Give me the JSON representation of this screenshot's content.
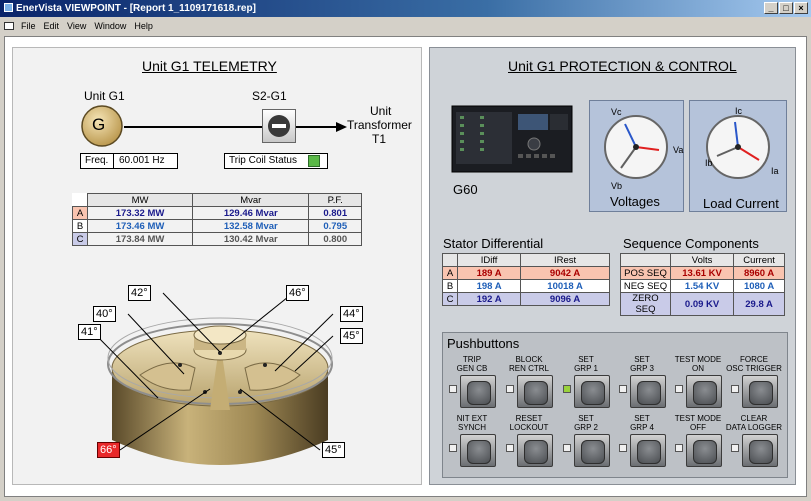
{
  "window": {
    "title": "EnerVista VIEWPOINT - [Report 1_1109171618.rep]",
    "controls": [
      "_",
      "□",
      "×"
    ]
  },
  "menu": {
    "items": [
      "File",
      "Edit",
      "View",
      "Window",
      "Help"
    ]
  },
  "telemetry": {
    "heading": "Unit G1 TELEMETRY",
    "unit_label": "Unit G1",
    "generator_symbol": "G",
    "breaker_label": "S2-G1",
    "transformer_label_1": "Unit",
    "transformer_label_2": "Transformer",
    "transformer_label_3": "T1",
    "freq_label": "Freq.",
    "freq_value": "60.001 Hz",
    "trip_coil_label": "Trip Coil Status",
    "trip_coil_color": "#5ab847",
    "table_headers": [
      "MW",
      "Mvar",
      "P.F."
    ],
    "rows": [
      {
        "phase": "A",
        "mw": "173.32 MW",
        "mvar": "129.46 Mvar",
        "pf": "0.801"
      },
      {
        "phase": "B",
        "mw": "173.46 MW",
        "mvar": "132.58 Mvar",
        "pf": "0.795"
      },
      {
        "phase": "C",
        "mw": "173.84 MW",
        "mvar": "130.42 Mvar",
        "pf": "0.800"
      }
    ],
    "temps": {
      "t42": "42°",
      "t46": "46°",
      "t40": "40°",
      "t44": "44°",
      "t41": "41°",
      "t45a": "45°",
      "t66": "66°",
      "t45b": "45°"
    },
    "alarm_color": "#e8282a"
  },
  "protection": {
    "heading": "Unit G1 PROTECTION & CONTROL",
    "relay_label": "G60",
    "voltages": {
      "label": "Voltages",
      "va": "Va",
      "vb": "Vb",
      "vc": "Vc"
    },
    "currents": {
      "label": "Load Current",
      "ia": "Ia",
      "ib": "Ib",
      "ic": "Ic"
    },
    "stator": {
      "title": "Stator Differential",
      "headers": [
        "IDiff",
        "IRest"
      ],
      "rows": [
        {
          "phase": "A",
          "idiff": "189 A",
          "irest": "9042 A"
        },
        {
          "phase": "B",
          "idiff": "198 A",
          "irest": "10018 A"
        },
        {
          "phase": "C",
          "idiff": "192 A",
          "irest": "9096 A"
        }
      ]
    },
    "sequence": {
      "title": "Sequence Components",
      "headers": [
        "Volts",
        "Current"
      ],
      "rows": [
        {
          "name": "POS SEQ",
          "volts": "13.61 KV",
          "current": "8960 A"
        },
        {
          "name": "NEG SEQ",
          "volts": "1.54 KV",
          "current": "1080 A"
        },
        {
          "name": "ZERO SEQ",
          "volts": "0.09 KV",
          "current": "29.8 A"
        }
      ]
    },
    "pushbuttons": {
      "title": "Pushbuttons",
      "buttons": [
        {
          "l1": "TRIP",
          "l2": "GEN CB",
          "led": false
        },
        {
          "l1": "BLOCK",
          "l2": "REN CTRL",
          "led": false
        },
        {
          "l1": "SET",
          "l2": "GRP 1",
          "led": true
        },
        {
          "l1": "SET",
          "l2": "GRP 3",
          "led": false
        },
        {
          "l1": "TEST MODE",
          "l2": "ON",
          "led": false
        },
        {
          "l1": "FORCE",
          "l2": "OSC TRIGGER",
          "led": false
        },
        {
          "l1": "NIT EXT",
          "l2": "SYNCH",
          "led": false
        },
        {
          "l1": "RESET",
          "l2": "LOCKOUT",
          "led": false
        },
        {
          "l1": "SET",
          "l2": "GRP 2",
          "led": false
        },
        {
          "l1": "SET",
          "l2": "GRP 4",
          "led": false
        },
        {
          "l1": "TEST MODE",
          "l2": "OFF",
          "led": false
        },
        {
          "l1": "CLEAR",
          "l2": "DATA LOGGER",
          "led": false
        }
      ]
    }
  }
}
